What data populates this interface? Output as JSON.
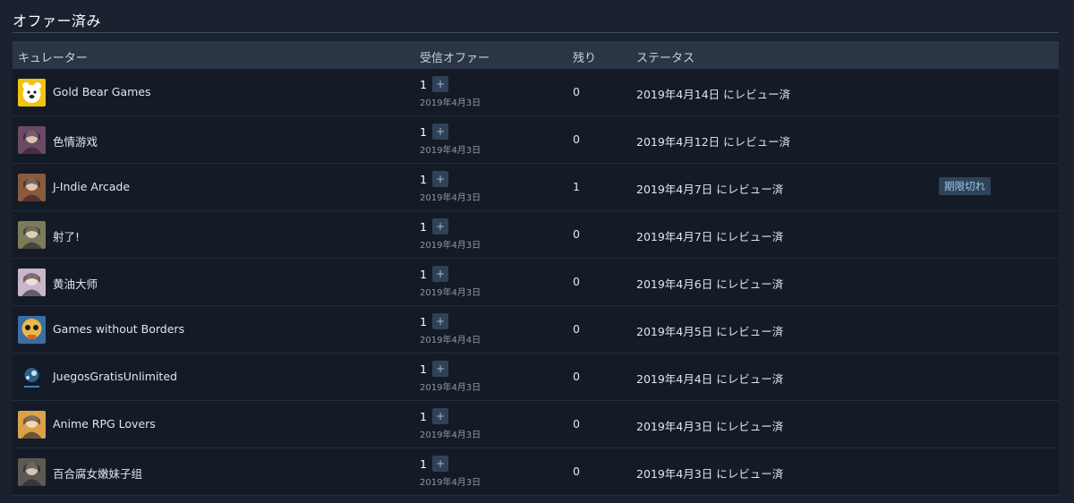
{
  "section": {
    "title": "オファー済み"
  },
  "columns": {
    "curator": "キュレーター",
    "received": "受信オファー",
    "remaining": "残り",
    "status": "ステータス"
  },
  "plus_label": "+",
  "rows": [
    {
      "name": "Gold Bear Games",
      "count": "1",
      "date": "2019年4月3日",
      "remaining": "0",
      "status": "2019年4月14日 にレビュー済",
      "badge": "",
      "avatar_icon": "gold-bear-avatar-icon",
      "avatar_color": "#e8c23a"
    },
    {
      "name": "色情游戏",
      "count": "1",
      "date": "2019年4月3日",
      "remaining": "0",
      "status": "2019年4月12日 にレビュー済",
      "badge": "",
      "avatar_icon": "anime-girl-avatar-icon",
      "avatar_color": "#6b4a63"
    },
    {
      "name": "J-Indie Arcade",
      "count": "1",
      "date": "2019年4月3日",
      "remaining": "1",
      "status": "2019年4月7日 にレビュー済",
      "badge": "期限切れ",
      "avatar_icon": "anime-portrait-avatar-icon",
      "avatar_color": "#8a5a3e"
    },
    {
      "name": "射了!",
      "count": "1",
      "date": "2019年4月3日",
      "remaining": "0",
      "status": "2019年4月7日 にレビュー済",
      "badge": "",
      "avatar_icon": "character-avatar-icon",
      "avatar_color": "#7b7d5a"
    },
    {
      "name": "黄油大师",
      "count": "1",
      "date": "2019年4月3日",
      "remaining": "0",
      "status": "2019年4月6日 にレビュー済",
      "badge": "",
      "avatar_icon": "anime-character-avatar-icon",
      "avatar_color": "#c9b6c9"
    },
    {
      "name": "Games without Borders",
      "count": "1",
      "date": "2019年4月4日",
      "remaining": "0",
      "status": "2019年4月5日 にレビュー済",
      "badge": "",
      "avatar_icon": "skull-avatar-icon",
      "avatar_color": "#c87a2a"
    },
    {
      "name": "JuegosGratisUnlimited",
      "count": "1",
      "date": "2019年4月3日",
      "remaining": "0",
      "status": "2019年4月4日 にレビュー済",
      "badge": "",
      "avatar_icon": "steam-logo-avatar-icon",
      "avatar_color": "#1f3b57"
    },
    {
      "name": "Anime RPG Lovers",
      "count": "1",
      "date": "2019年4月3日",
      "remaining": "0",
      "status": "2019年4月3日 にレビュー済",
      "badge": "",
      "avatar_icon": "anime-blonde-avatar-icon",
      "avatar_color": "#d9a24a"
    },
    {
      "name": "百合腐女嫩妹子组",
      "count": "1",
      "date": "2019年4月3日",
      "remaining": "0",
      "status": "2019年4月3日 にレビュー済",
      "badge": "",
      "avatar_icon": "dark-character-avatar-icon",
      "avatar_color": "#5a5a52"
    }
  ],
  "colors": {
    "page_bg": "#1a2230",
    "header_bg": "#2a3545",
    "row_bg": "#141b26",
    "button_bg": "#2f4257",
    "badge_text": "#9fc7e8"
  }
}
